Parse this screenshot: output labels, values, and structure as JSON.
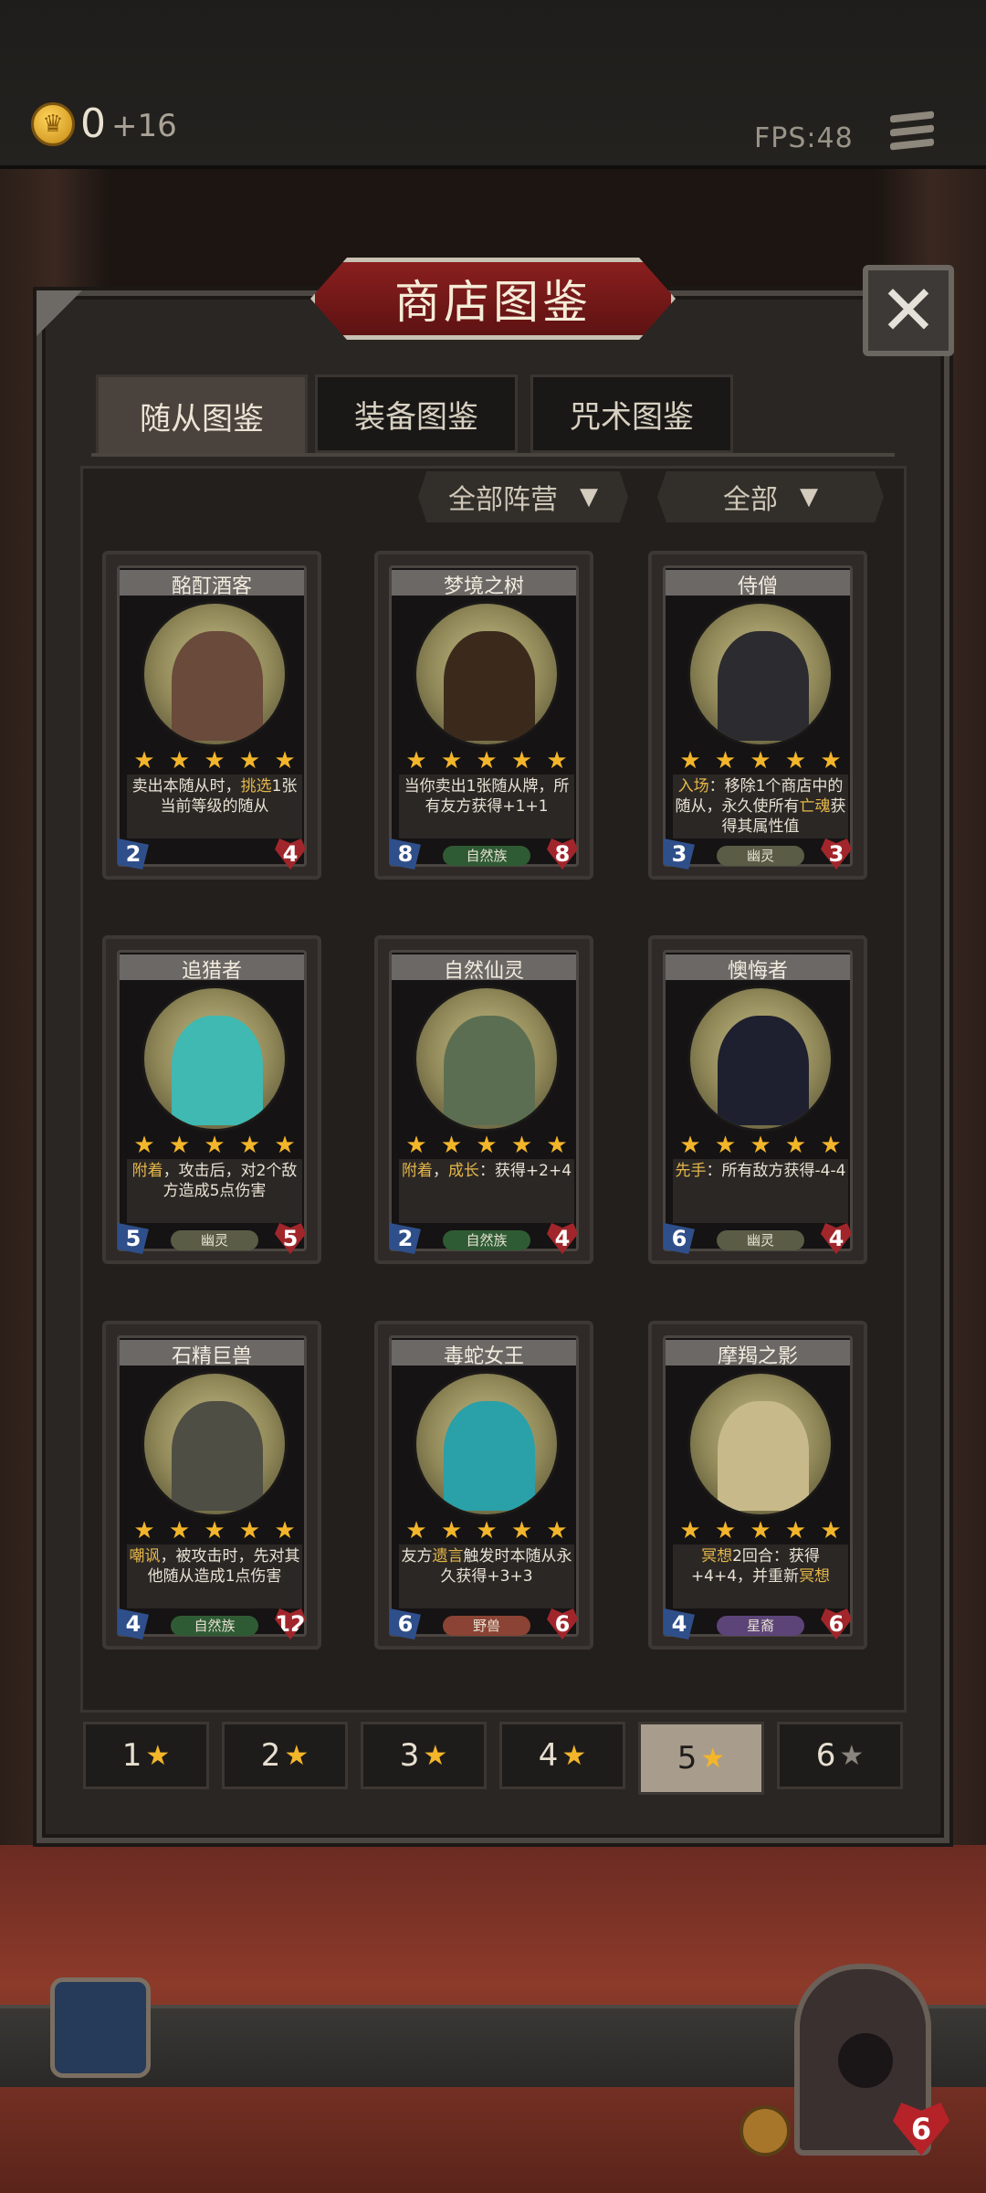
{
  "hud": {
    "gold": "0",
    "gold_income": "+16",
    "fps": "FPS:48"
  },
  "dialog": {
    "title": "商店图鉴",
    "close_icon": "close-icon"
  },
  "tabs": [
    {
      "label": "随从图鉴",
      "active": true
    },
    {
      "label": "装备图鉴",
      "active": false
    },
    {
      "label": "咒术图鉴",
      "active": false
    }
  ],
  "filters": {
    "faction": "全部阵营",
    "type": "全部"
  },
  "cards": [
    {
      "name": "酩酊酒客",
      "desc": "卖出本随从时，挑选1张当前等级的随从",
      "atk": "2",
      "hp": "4",
      "tribe": ""
    },
    {
      "name": "梦境之树",
      "desc": "当你卖出1张随从牌，所有友方获得+1+1",
      "atk": "8",
      "hp": "8",
      "tribe": "自然族"
    },
    {
      "name": "侍僧",
      "desc": "入场：移除1个商店中的随从，永久使所有亡魂获得其属性值",
      "atk": "3",
      "hp": "3",
      "tribe": "幽灵"
    },
    {
      "name": "追猎者",
      "desc": "附着，攻击后，对2个敌方造成5点伤害",
      "atk": "5",
      "hp": "5",
      "tribe": "幽灵"
    },
    {
      "name": "自然仙灵",
      "desc": "附着，成长：获得+2+4",
      "atk": "2",
      "hp": "4",
      "tribe": "自然族"
    },
    {
      "name": "懊悔者",
      "desc": "先手：所有敌方获得-4-4",
      "atk": "6",
      "hp": "4",
      "tribe": "幽灵"
    },
    {
      "name": "石精巨兽",
      "desc": "嘲讽，被攻击时，先对其他随从造成1点伤害",
      "atk": "4",
      "hp": "12",
      "tribe": "自然族"
    },
    {
      "name": "毒蛇女王",
      "desc": "友方遗言触发时本随从永久获得+3+3",
      "atk": "6",
      "hp": "6",
      "tribe": "野兽"
    },
    {
      "name": "摩羯之影",
      "desc": "冥想2回合：获得+4+4，并重新冥想",
      "atk": "4",
      "hp": "6",
      "tribe": "星裔"
    }
  ],
  "star_tabs": [
    {
      "label": "1",
      "active": false
    },
    {
      "label": "2",
      "active": false
    },
    {
      "label": "3",
      "active": false
    },
    {
      "label": "4",
      "active": false
    },
    {
      "label": "5",
      "active": true
    },
    {
      "label": "6",
      "active": false
    }
  ],
  "player": {
    "health": "6"
  },
  "colors": {
    "star": "#f3b52a",
    "keyword": "#e6b84a",
    "title_red": "#8a1f1f"
  }
}
